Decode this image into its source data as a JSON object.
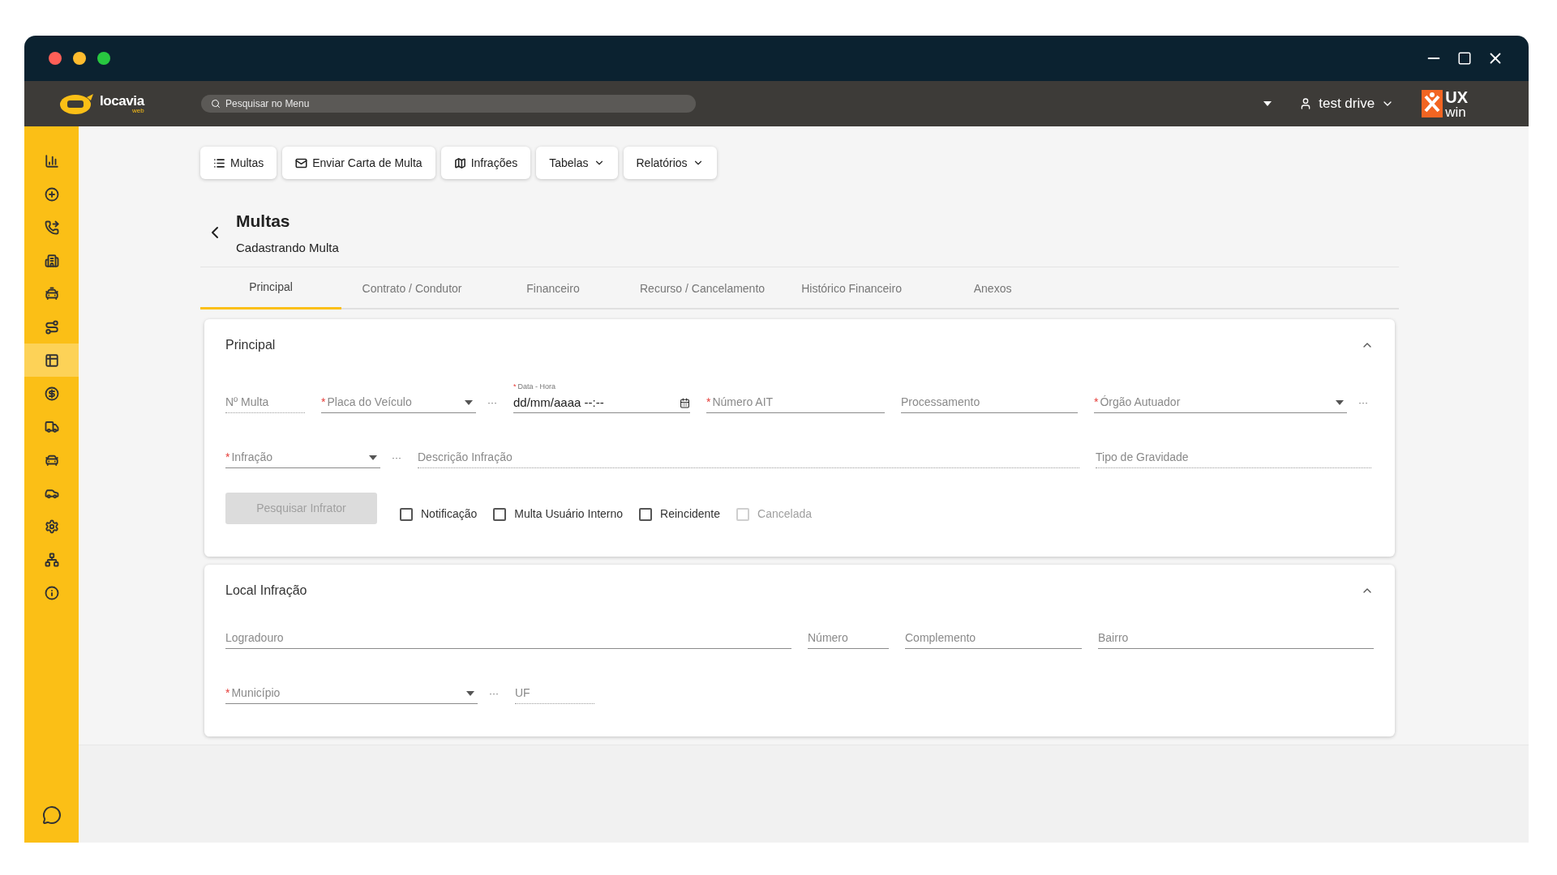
{
  "header": {
    "logo": {
      "text": "locavia",
      "subtext": "web"
    },
    "search": {
      "placeholder": "Pesquisar no Menu"
    },
    "user": "test drive",
    "brand": {
      "text": "UX",
      "subtext": "win"
    }
  },
  "sidebar": {
    "items": [
      {
        "selected": false
      },
      {
        "selected": false
      },
      {
        "selected": false
      },
      {
        "selected": false
      },
      {
        "selected": false
      },
      {
        "selected": false
      },
      {
        "selected": true
      },
      {
        "selected": false
      },
      {
        "selected": false
      },
      {
        "selected": false
      },
      {
        "selected": false
      },
      {
        "selected": false
      },
      {
        "selected": false
      },
      {
        "selected": false
      }
    ]
  },
  "toolbar": [
    {
      "label": "Multas",
      "dropdown": false
    },
    {
      "label": "Enviar Carta de Multa",
      "dropdown": false
    },
    {
      "label": "Infrações",
      "dropdown": false
    },
    {
      "label": "Tabelas",
      "dropdown": true
    },
    {
      "label": "Relatórios",
      "dropdown": true
    }
  ],
  "page": {
    "title": "Multas",
    "subtitle": "Cadastrando Multa"
  },
  "tabs": [
    {
      "label": "Principal",
      "selected": true
    },
    {
      "label": "Contrato / Condutor",
      "selected": false
    },
    {
      "label": "Financeiro",
      "selected": false
    },
    {
      "label": "Recurso / Cancelamento",
      "selected": false
    },
    {
      "label": "Histórico Financeiro",
      "selected": false
    },
    {
      "label": "Anexos",
      "selected": false
    }
  ],
  "sections": [
    {
      "title": "Principal",
      "expanded": true,
      "fields": [
        {
          "kind": "input",
          "label": "Nº Multa",
          "readonly": true
        },
        {
          "kind": "select",
          "label": "Placa do Veículo",
          "required_mark": "*",
          "readonly": false,
          "more": "···"
        },
        {
          "kind": "datetime",
          "label": "Data - Hora",
          "value": "dd/mm/aaaa --:--",
          "required_mark": "*",
          "readonly": false
        },
        {
          "kind": "input",
          "label": "Número AIT",
          "required_mark": "*",
          "readonly": false
        },
        {
          "kind": "input",
          "label": "Processamento",
          "readonly": false
        },
        {
          "kind": "select",
          "label": "Órgão Autuador",
          "required_mark": "*",
          "readonly": false,
          "more": "···"
        },
        {
          "kind": "select",
          "label": "Infração",
          "required_mark": "*",
          "readonly": false,
          "more": "···"
        },
        {
          "kind": "input",
          "label": "Descrição Infração",
          "readonly": true
        },
        {
          "kind": "input",
          "label": "Tipo de Gravidade",
          "readonly": true
        }
      ],
      "button": {
        "label": "Pesquisar Infrator",
        "disabled": true
      },
      "checkboxes": [
        {
          "label": "Notificação",
          "checked": false,
          "disabled": false
        },
        {
          "label": "Multa Usuário Interno",
          "checked": false,
          "disabled": false
        },
        {
          "label": "Reincidente",
          "checked": false,
          "disabled": false
        },
        {
          "label": "Cancelada",
          "checked": false,
          "disabled": true
        }
      ]
    },
    {
      "title": "Local Infração",
      "expanded": true,
      "fields": [
        {
          "kind": "input",
          "label": "Logradouro",
          "readonly": false
        },
        {
          "kind": "input",
          "label": "Número",
          "readonly": false
        },
        {
          "kind": "input",
          "label": "Complemento",
          "readonly": false
        },
        {
          "kind": "input",
          "label": "Bairro",
          "readonly": false
        },
        {
          "kind": "select",
          "label": "Município",
          "required_mark": "*",
          "readonly": false,
          "more": "···"
        },
        {
          "kind": "input",
          "label": "UF",
          "readonly": true
        }
      ]
    }
  ]
}
